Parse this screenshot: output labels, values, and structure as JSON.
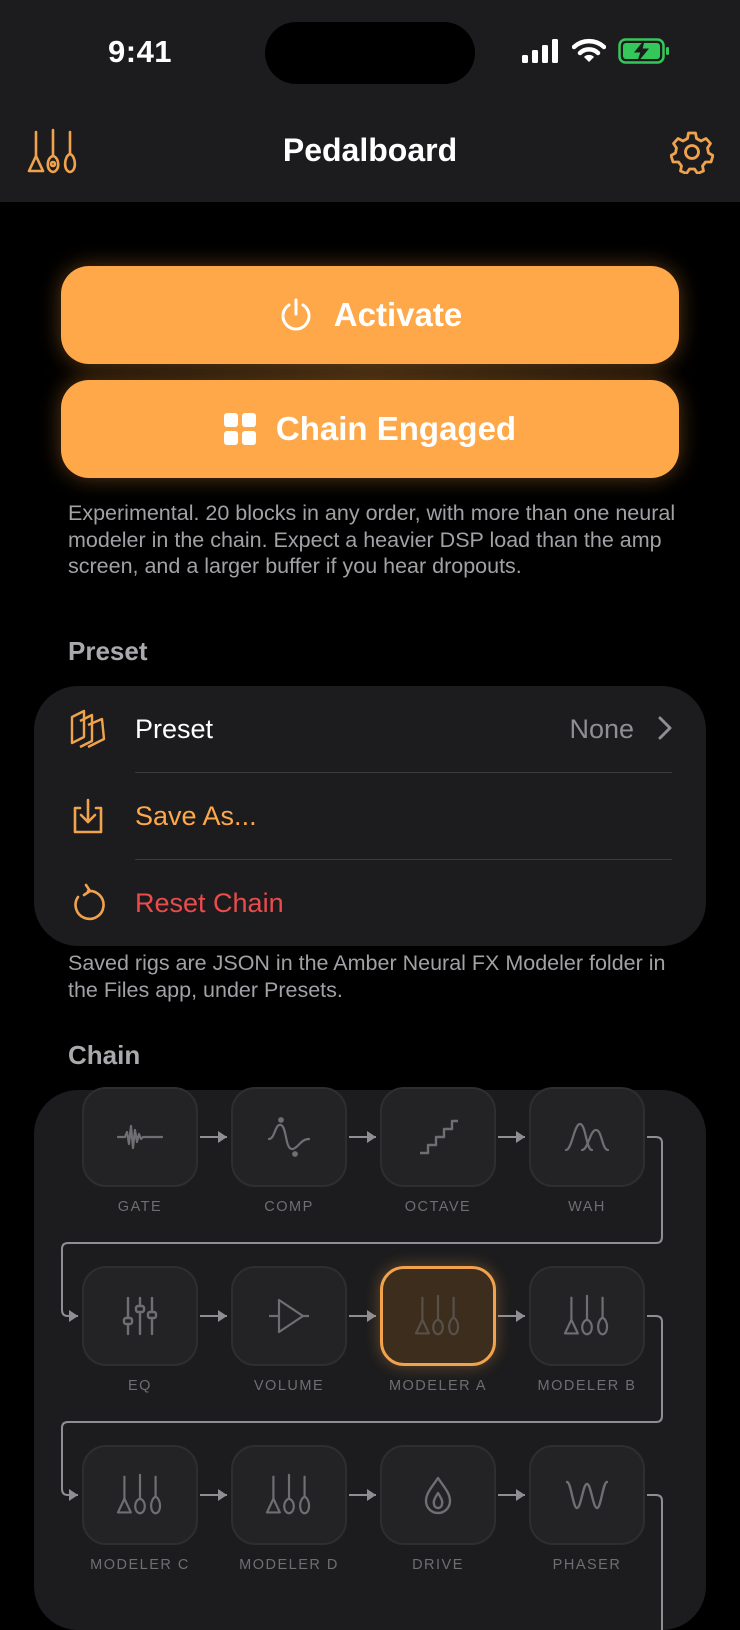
{
  "status_bar": {
    "time": "9:41"
  },
  "nav": {
    "title": "Pedalboard"
  },
  "buttons": {
    "activate_label": "Activate",
    "chain_label": "Chain Engaged"
  },
  "description": "Experimental. 20 blocks in any order, with more than one neural modeler in the chain. Expect a heavier DSP load than the amp screen, and a larger buffer if you hear dropouts.",
  "preset_section": {
    "header": "Preset",
    "rows": [
      {
        "label": "Preset",
        "value": "None"
      },
      {
        "label": "Save As..."
      },
      {
        "label": "Reset Chain"
      }
    ],
    "footer": "Saved rigs are JSON in the Amber Neural FX Modeler folder in the Files app, under Presets."
  },
  "chain_section": {
    "header": "Chain",
    "blocks": [
      {
        "label": "GATE",
        "icon": "gate-waveform-icon"
      },
      {
        "label": "COMP",
        "icon": "compressor-icon"
      },
      {
        "label": "OCTAVE",
        "icon": "octave-steps-icon"
      },
      {
        "label": "WAH",
        "icon": "wah-curve-icon"
      },
      {
        "label": "EQ",
        "icon": "eq-sliders-icon"
      },
      {
        "label": "VOLUME",
        "icon": "volume-triangle-icon"
      },
      {
        "label": "MODELER A",
        "icon": "modeler-guitars-icon",
        "active": true
      },
      {
        "label": "MODELER B",
        "icon": "modeler-guitars-icon"
      },
      {
        "label": "MODELER C",
        "icon": "modeler-guitars-icon"
      },
      {
        "label": "MODELER D",
        "icon": "modeler-guitars-icon"
      },
      {
        "label": "DRIVE",
        "icon": "drive-drop-icon"
      },
      {
        "label": "PHASER",
        "icon": "phaser-wave-icon"
      }
    ]
  },
  "colors": {
    "accent": "#ffa84a",
    "destructive": "#eb4b4b",
    "card": "#1c1c1e",
    "battery": "#34c759"
  }
}
